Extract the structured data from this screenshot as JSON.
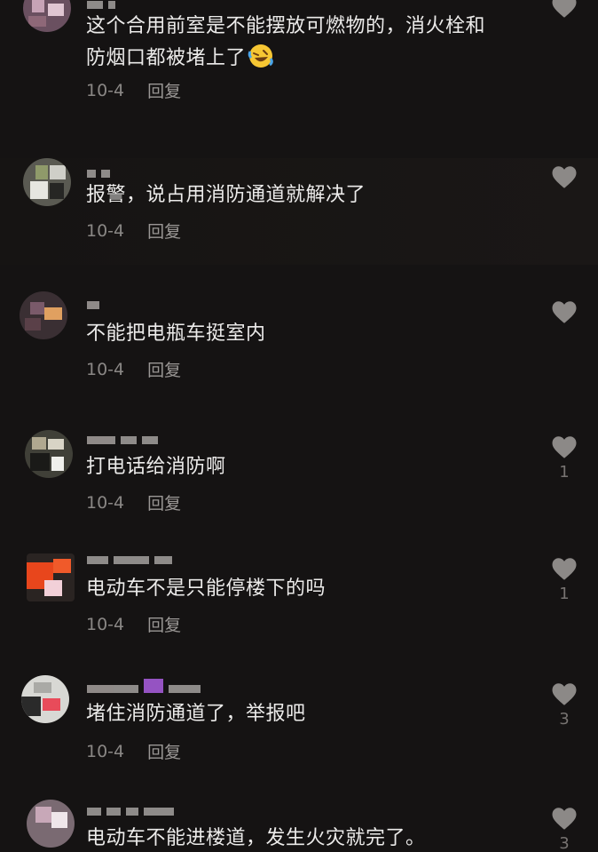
{
  "comments": [
    {
      "text": "这个合用前室是不能摆放可燃物的，消火栓和防烟口都被堵上了",
      "line2": "防烟口都被堵上了",
      "line1": "这个合用前室是不能摆放可燃物的，消火栓和",
      "emoji": "rolling-on-floor-laughing-emoji",
      "date": "10-4",
      "reply_label": "回复",
      "likes": ""
    },
    {
      "text": "报警，说占用消防通道就解决了",
      "date": "10-4",
      "reply_label": "回复",
      "likes": ""
    },
    {
      "text": "不能把电瓶车挺室内",
      "date": "10-4",
      "reply_label": "回复",
      "likes": ""
    },
    {
      "text": "打电话给消防啊",
      "date": "10-4",
      "reply_label": "回复",
      "likes": "1"
    },
    {
      "text": "电动车不是只能停楼下的吗",
      "date": "10-4",
      "reply_label": "回复",
      "likes": "1"
    },
    {
      "text": "堵住消防通道了，举报吧",
      "date": "10-4",
      "reply_label": "回复",
      "likes": "3"
    },
    {
      "text": "电动车不能进楼道，发生火灾就完了。",
      "likes": "3"
    }
  ],
  "colors": {
    "background": "#151313",
    "text": "#ecebea",
    "meta": "#8a8785",
    "heart": "#8c8987"
  },
  "icons": {
    "like": "heart-icon",
    "avatar": "pixelated-avatar"
  }
}
